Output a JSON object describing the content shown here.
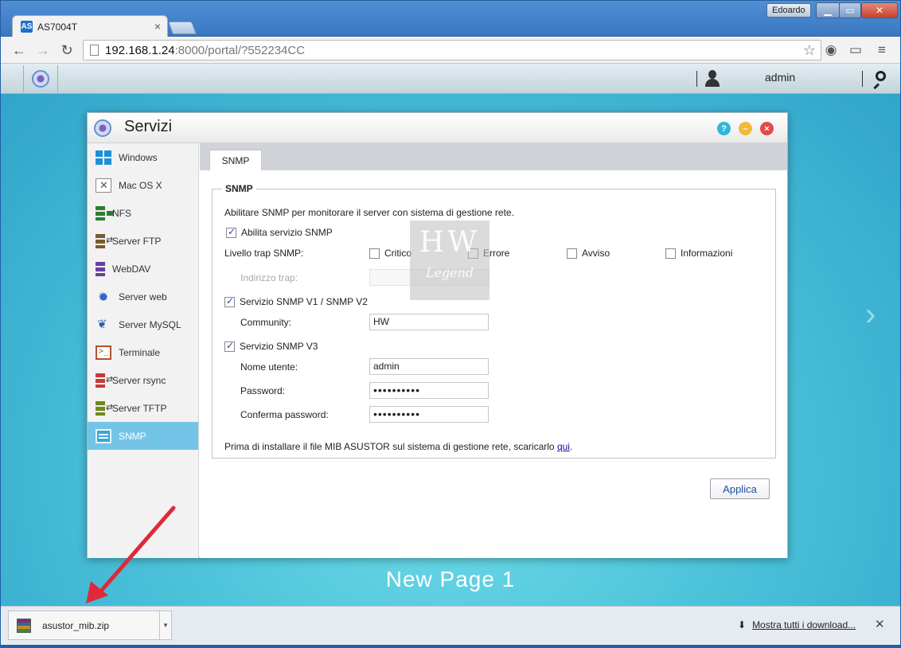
{
  "browser": {
    "tab_title": "AS7004T",
    "tab_logo": "AS",
    "user": "Edoardo",
    "url_host": "192.168.1.24",
    "url_rest": ":8000/portal/?552234CC"
  },
  "adm": {
    "user": "admin",
    "page_label": "New Page 1"
  },
  "window": {
    "title": "Servizi",
    "sidebar": [
      {
        "label": "Windows",
        "icon": "windows-icon"
      },
      {
        "label": "Mac OS X",
        "icon": "macos-icon"
      },
      {
        "label": "NFS",
        "icon": "nfs-icon"
      },
      {
        "label": "Server FTP",
        "icon": "ftp-icon"
      },
      {
        "label": "WebDAV",
        "icon": "webdav-icon"
      },
      {
        "label": "Server web",
        "icon": "web-server-icon"
      },
      {
        "label": "Server MySQL",
        "icon": "mysql-icon"
      },
      {
        "label": "Terminale",
        "icon": "terminal-icon"
      },
      {
        "label": "Server rsync",
        "icon": "rsync-icon"
      },
      {
        "label": "Server TFTP",
        "icon": "tftp-icon"
      },
      {
        "label": "SNMP",
        "icon": "snmp-icon",
        "active": true
      }
    ],
    "tab": "SNMP",
    "section_title": "SNMP",
    "description": "Abilitare SNMP per monitorare il server con sistema di gestione rete.",
    "enable_label": "Abilita servizio SNMP",
    "trap_level_label": "Livello trap SNMP:",
    "trap_levels": [
      "Critico",
      "Errore",
      "Avviso",
      "Informazioni"
    ],
    "trap_address_label": "Indirizzo trap:",
    "trap_address_value": "",
    "v1v2_label": "Servizio SNMP V1 / SNMP V2",
    "community_label": "Community:",
    "community_value": "HW",
    "v3_label": "Servizio SNMP V3",
    "username_label": "Nome utente:",
    "username_value": "admin",
    "password_label": "Password:",
    "password_value": "••••••••••",
    "confirm_label": "Conferma password:",
    "confirm_value": "••••••••••",
    "mib_text": "Prima di installare il file MIB ASUSTOR sul sistema di gestione rete, scaricarlo ",
    "mib_link": "qui",
    "mib_end": ".",
    "apply_label": "Applica"
  },
  "watermark": {
    "line1": "HW",
    "line2": "Legend"
  },
  "downloads": {
    "file": "asustor_mib.zip",
    "show_all": "Mostra tutti i download..."
  },
  "colors": {
    "accent": "#74c4e8",
    "annotation_arrow": "#e0283a"
  }
}
